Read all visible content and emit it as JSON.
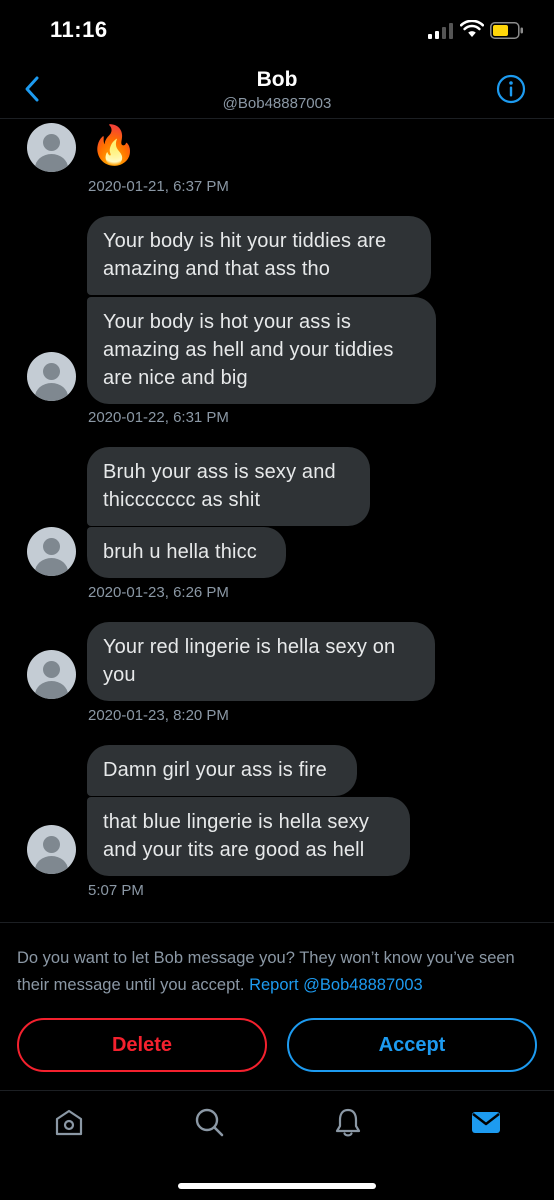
{
  "status_bar": {
    "time": "11:16"
  },
  "header": {
    "title": "Bob",
    "handle": "@Bob48887003"
  },
  "messages": {
    "g1": {
      "emoji": "🔥",
      "timestamp": "2020-01-21, 6:37 PM"
    },
    "g2": {
      "m1": "Your body is hit your tiddies are amazing and that ass tho",
      "m2": "Your body is hot your ass is amazing as hell and your tiddies are nice and big",
      "timestamp": "2020-01-22, 6:31 PM"
    },
    "g3": {
      "m1": "Bruh your ass is sexy and thiccccccc as shit",
      "m2": "bruh u hella thicc",
      "timestamp": "2020-01-23, 6:26 PM"
    },
    "g4": {
      "m1": "Your red lingerie is hella sexy on you",
      "timestamp": "2020-01-23, 8:20 PM"
    },
    "g5": {
      "m1": "Damn girl your ass is fire",
      "m2": "that blue lingerie is hella sexy and your tits are good as hell",
      "timestamp": "5:07 PM"
    }
  },
  "request": {
    "text": "Do you want to let Bob message you? They won’t know you’ve seen their message until you accept.",
    "report_link": "Report @Bob48887003"
  },
  "actions": {
    "delete_label": "Delete",
    "accept_label": "Accept"
  },
  "colors": {
    "background": "#000000",
    "bubble": "#2f3336",
    "accent_blue": "#1d9bf0",
    "danger_red": "#f4212e",
    "muted_text": "#8b98a5"
  },
  "icons": {
    "back": "chevron-left-icon",
    "info": "info-icon",
    "home": "home-icon",
    "search": "search-icon",
    "notifications": "bell-icon",
    "messages": "mail-icon"
  }
}
